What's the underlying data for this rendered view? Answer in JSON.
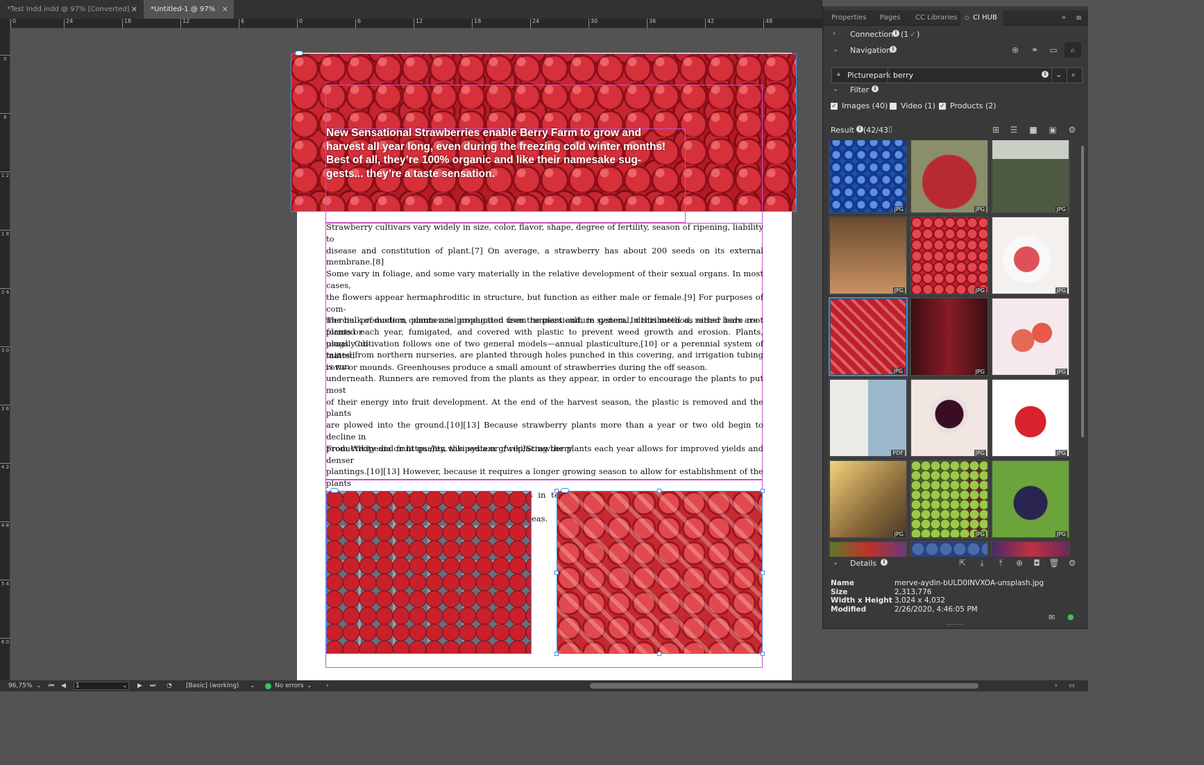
{
  "tabs": [
    {
      "label": "*Test Indd.indd @ 97% [Converted]",
      "active": false
    },
    {
      "label": "*Untitled-1 @ 97%",
      "active": true
    }
  ],
  "ruler_h": [
    "0",
    "24",
    "18",
    "12",
    "6",
    "0",
    "6",
    "12",
    "18",
    "24",
    "30",
    "36",
    "42",
    "48"
  ],
  "ruler_v": [
    "0",
    "6",
    "1 2",
    "1 8",
    "2 4",
    "3 0",
    "3 6",
    "4 2",
    "4 8",
    "5 4",
    "6 0"
  ],
  "document": {
    "headline": "New Sensational Strawberries enable Berry Farm to grow and harvest all year long, even during the freezing cold winter months! Best of all, they’re 100% organic and like their namesake sug-gests... they’re a taste sensation.",
    "headline_lines": [
      "New Sensational Strawberries enable Berry Farm to grow and",
      "harvest all year long, even during the freezing cold winter months!",
      "Best of all, they’re 100% organic and like their namesake sug-",
      "gests... they’re a taste sensation."
    ],
    "para1_lines": [
      "Strawberry cultivars vary widely in size, color, flavor, shape, degree of fertility, season of ripening, liability to",
      "disease and constitution of plant.[7] On average, a strawberry has about 200 seeds on its external membrane.[8]",
      "Some vary in foliage, and some vary materially in the relative development of their sexual organs. In most cases,",
      "the flowers appear hermaphroditic in structure, but function as either male or female.[9] For purposes of com-",
      "mercial production, plants are propagated from runners and, in general, distributed as either bare root plants or",
      "plugs. Cultivation follows one of two general models—annual plasticulture,[10] or a perennial system of matted",
      "rows or mounds. Greenhouses produce a small amount of strawberries during the off season."
    ],
    "para2_lines": [
      "The bulk of modern commercial production uses the plasticulture system. In this method, raised beds are",
      "formed each year, fumigated, and covered with plastic to prevent weed growth and erosion. Plants, usually ob-",
      "tained from northern nurseries, are planted through holes punched in this covering, and irrigation tubing is run",
      "underneath. Runners are removed from the plants as they appear, in order to encourage the plants to put most",
      "of their energy into fruit development. At the end of the harvest season, the plastic is removed and the plants",
      "are plowed into the ground.[10][13] Because strawberry plants more than a year or two old begin to decline in",
      "productivity and fruit quality, this system of replacing the plants each year allows for improved yields and denser",
      "plantings.[10][13] However, because it requires a longer growing season to allow for establishment of the plants",
      "each year, and because of the increased costs in terms of forming and covering the mounds and purchasing",
      "plants each year, it is not always practical in all areas."
    ],
    "source": "From Wikipedia on https://en.wikipedia.org/wiki/Strawberry"
  },
  "status": {
    "zoom": "96,75%",
    "page": "1",
    "style": "[Basic] (working)",
    "errors": "No errors"
  },
  "panel": {
    "tabs": [
      "Properties",
      "Pages",
      "CC Libraries",
      "CI HUB"
    ],
    "active_tab": "CI HUB",
    "connections": {
      "label": "Connections",
      "count_open": "(1",
      "count_close": ")"
    },
    "navigation": {
      "label": "Navigation"
    },
    "search": {
      "source": "Picturepark",
      "query": "berry"
    },
    "filter": {
      "label": "Filter",
      "options": [
        {
          "label": "Images (40)",
          "checked": true
        },
        {
          "label": "Video (1)",
          "checked": false
        },
        {
          "label": "Products (2)",
          "checked": true
        }
      ]
    },
    "result": {
      "label": "Result",
      "count": "(42/43"
    },
    "thumbs": [
      {
        "fmt": "JPG",
        "kind": "blueberry"
      },
      {
        "fmt": "JPG",
        "kind": "basket"
      },
      {
        "fmt": "JPG",
        "kind": "vine"
      },
      {
        "fmt": "JPG",
        "kind": "dessert"
      },
      {
        "fmt": "JPG",
        "kind": "berries"
      },
      {
        "fmt": "JPG",
        "kind": "bowl"
      },
      {
        "fmt": "JPG",
        "kind": "slices",
        "selected": true
      },
      {
        "fmt": "JPG",
        "kind": "drink"
      },
      {
        "fmt": "JPG",
        "kind": "cocktail"
      },
      {
        "fmt": "PDF",
        "kind": "doc"
      },
      {
        "fmt": "JPG",
        "kind": "jam"
      },
      {
        "fmt": "JPG",
        "kind": "single"
      },
      {
        "fmt": "JPG",
        "kind": "person"
      },
      {
        "fmt": "JPG",
        "kind": "market"
      },
      {
        "fmt": "JPG",
        "kind": "grapes"
      },
      {
        "fmt": "",
        "kind": "market2"
      },
      {
        "fmt": "",
        "kind": "blueberry2"
      },
      {
        "fmt": "",
        "kind": "mix"
      }
    ],
    "details": {
      "label": "Details",
      "rows": [
        {
          "key": "Name",
          "value": "merve-aydin-bULD0INVXOA-unsplash.jpg"
        },
        {
          "key": "Size",
          "value": "2,313,776"
        },
        {
          "key": "Width x Height",
          "value": "3,024 x 4,032"
        },
        {
          "key": "Modified",
          "value": "2/26/2020, 4:46:05 PM"
        }
      ]
    }
  },
  "colors": {
    "accent": "#3a8ee6",
    "ok": "#3cc35a",
    "bg": "#535353"
  }
}
